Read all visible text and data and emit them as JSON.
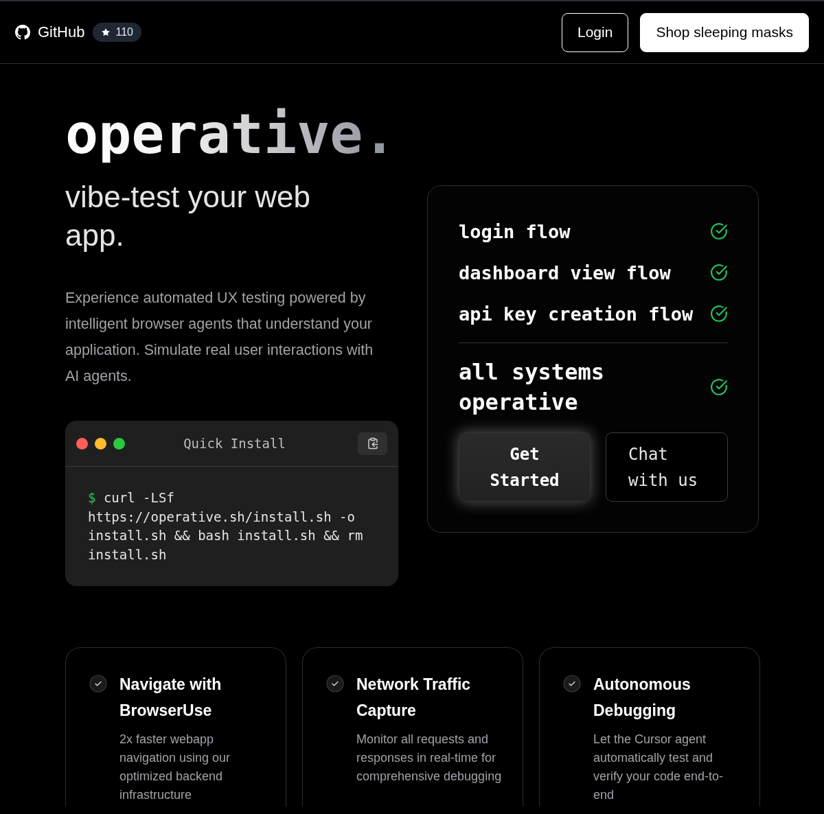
{
  "navbar": {
    "github_label": "GitHub",
    "stars": "110",
    "buttons": [
      {
        "label": "Login",
        "kind": "outline"
      },
      {
        "label": "Shop sleeping masks",
        "kind": "solid"
      }
    ]
  },
  "hero": {
    "title": "operative.",
    "subtitle": "vibe-test your web app.",
    "description": "Experience automated UX testing powered by intelligent browser agents that understand your application. Simulate real user interactions with AI agents."
  },
  "install": {
    "title": "Quick Install",
    "prompt": "$",
    "command": "curl -LSf https://operative.sh/install.sh -o install.sh && bash install.sh && rm install.sh"
  },
  "status": {
    "checks": [
      {
        "label": "login flow",
        "checked": true
      },
      {
        "label": "dashboard view flow",
        "checked": true
      },
      {
        "label": "api key creation flow",
        "checked": true
      }
    ],
    "summary": {
      "label": "all systems operative",
      "checked": true
    },
    "buttons": [
      {
        "label": "Get Started",
        "kind": "primary"
      },
      {
        "label": "Chat with us",
        "kind": "secondary"
      }
    ]
  },
  "features": [
    {
      "title": "Navigate with BrowserUse",
      "description": "2x faster webapp navigation using our optimized backend infrastructure"
    },
    {
      "title": "Network Traffic Capture",
      "description": "Monitor all requests and responses in real-time for comprehensive debugging"
    },
    {
      "title": "Autonomous Debugging",
      "description": "Let the Cursor agent automatically test and verify your code end-to-end"
    }
  ]
}
